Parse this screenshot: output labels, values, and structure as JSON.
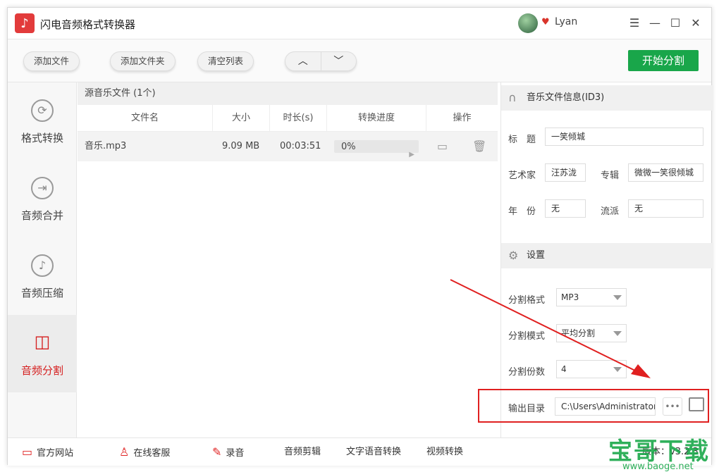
{
  "app": {
    "title": "闪电音频格式转换器",
    "username": "Lyan"
  },
  "toolbar": {
    "add_file": "添加文件",
    "add_folder": "添加文件夹",
    "clear_list": "清空列表",
    "up": "︿",
    "down": "﹀",
    "start": "开始分割"
  },
  "sidebar": {
    "items": [
      {
        "label": "格式转换",
        "icon": "refresh-icon"
      },
      {
        "label": "音频合并",
        "icon": "merge-icon"
      },
      {
        "label": "音频压缩",
        "icon": "music-note-icon"
      },
      {
        "label": "音频分割",
        "icon": "split-icon"
      }
    ]
  },
  "files": {
    "header": "源音乐文件 (1个)",
    "columns": [
      "文件名",
      "大小",
      "时长(s)",
      "转换进度",
      "操作"
    ],
    "rows": [
      {
        "name": "音乐.mp3",
        "size": "9.09 MB",
        "duration": "00:03:51",
        "progress": "0%"
      }
    ]
  },
  "id3": {
    "header": "音乐文件信息(ID3)",
    "title_label": "标　题",
    "title": "一笑倾城",
    "artist_label": "艺术家",
    "artist": "汪苏泷",
    "album_label": "专辑",
    "album": "微微一笑很倾城",
    "year_label": "年　份",
    "year": "无",
    "genre_label": "流派",
    "genre": "无"
  },
  "settings": {
    "header": "设置",
    "format_label": "分割格式",
    "format": "MP3",
    "mode_label": "分割模式",
    "mode": "平均分割",
    "count_label": "分割份数",
    "count": "4",
    "output_label": "输出目录",
    "output": "C:\\Users\\Administrator"
  },
  "bottom": {
    "website": "官方网站",
    "support": "在线客服",
    "record": "录音",
    "edit": "音频剪辑",
    "tts": "文字语音转换",
    "video": "视频转换",
    "version": "版本：v3.2.3"
  },
  "watermark": {
    "text": "宝哥下载",
    "url": "www.baoge.net"
  },
  "colors": {
    "accent_green": "#19a64a",
    "accent_red": "#d52020"
  }
}
